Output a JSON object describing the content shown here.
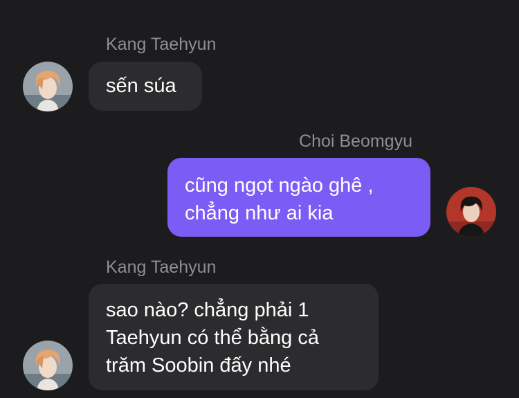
{
  "messages": [
    {
      "sender": "Kang Taehyun",
      "direction": "incoming",
      "lines": [
        "sến súa"
      ]
    },
    {
      "sender": "Choi Beomgyu",
      "direction": "outgoing",
      "lines": [
        "cũng ngọt ngào ghê ,",
        "chẳng như ai kia"
      ]
    },
    {
      "sender": "Kang Taehyun",
      "direction": "incoming",
      "lines": [
        "sao nào? chẳng phải 1",
        "Taehyun có thể bằng cả",
        "trăm Soobin đấy nhé"
      ]
    }
  ],
  "colors": {
    "background": "#1c1c1e",
    "incoming_bubble": "#2c2c2e",
    "outgoing_bubble": "#7b5cf5",
    "sender_name": "#8e8e93",
    "message_text": "#ffffff"
  },
  "avatars": {
    "kang_taehyun": "photo of a person with light orange hair",
    "choi_beomgyu": "photo of a person with dark hair on red background"
  }
}
